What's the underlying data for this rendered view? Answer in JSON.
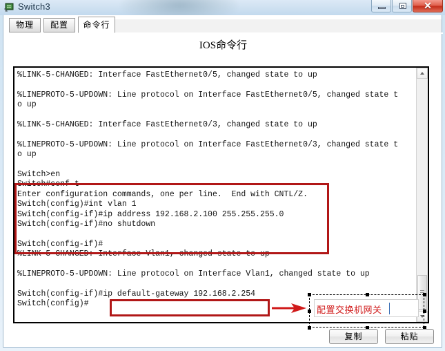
{
  "window": {
    "title": "Switch3",
    "icon": "switch-device-icon",
    "caption_buttons": {
      "minimize": "minimize-icon",
      "maximize": "maximize-icon",
      "close": "✕"
    }
  },
  "tabs": [
    {
      "label": "物理",
      "active": false
    },
    {
      "label": "配置",
      "active": false
    },
    {
      "label": "命令行",
      "active": true
    }
  ],
  "panel": {
    "title": "IOS命令行"
  },
  "terminal": {
    "lines": "%LINK-5-CHANGED: Interface FastEthernet0/5, changed state to up\n\n%LINEPROTO-5-UPDOWN: Line protocol on Interface FastEthernet0/5, changed state t\no up\n\n%LINK-5-CHANGED: Interface FastEthernet0/3, changed state to up\n\n%LINEPROTO-5-UPDOWN: Line protocol on Interface FastEthernet0/3, changed state t\no up\n\nSwitch>en\nSwitch#conf t\nEnter configuration commands, one per line.  End with CNTL/Z.\nSwitch(config)#int vlan 1\nSwitch(config-if)#ip address 192.168.2.100 255.255.255.0\nSwitch(config-if)#no shutdown\n\nSwitch(config-if)#\n%LINK-5-CHANGED: Interface Vlan1, changed state to up\n\n%LINEPROTO-5-UPDOWN: Line protocol on Interface Vlan1, changed state to up\n\nSwitch(config-if)#ip default-gateway 192.168.2.254\nSwitch(config)#",
    "scrollbar": {
      "up_arrow": "scroll-up-icon",
      "down_arrow": "scroll-down-icon"
    }
  },
  "annotations": {
    "config_box_color": "#b11717",
    "gateway_box_color": "#b11717",
    "arrow_color": "#d01a1a",
    "note_text": "配置交换机网关",
    "note_text_color": "#d01a1a"
  },
  "buttons": {
    "copy": "复制",
    "paste": "粘贴"
  }
}
